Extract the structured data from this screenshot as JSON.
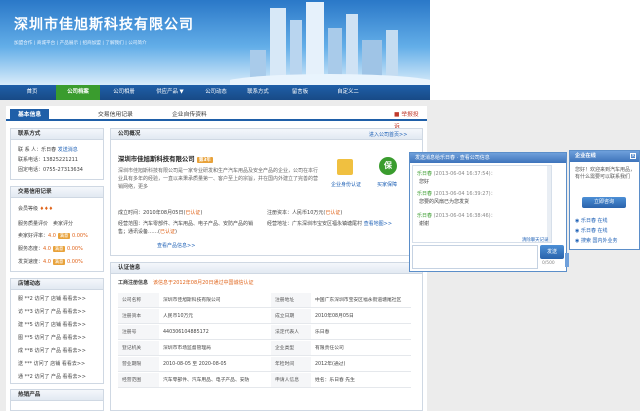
{
  "banner": {
    "title": "深圳市佳旭斯科技有限公司",
    "subtitle": "加盟合作 | 商城平台 | 产品展示 | 招商加盟 | 了解我们 | 公司简介"
  },
  "nav": [
    "首页",
    "公司档案",
    "公司相册",
    "供应产品 ▼",
    "公司动态",
    "联系方式",
    "留言板",
    "自定义二"
  ],
  "tabs": {
    "basic": "基本信息",
    "credit": "交易信用记录",
    "self": "企业自传资料",
    "report": "举报投诉"
  },
  "contact": {
    "title": "联系方式",
    "person": "联 系 人：乐日春",
    "chat_link": "发送消息",
    "mobile": "联系电话：13825221211",
    "phone": "固定电话：0755-27313634"
  },
  "trade": {
    "title": "交易信用记录",
    "level_label": "会员等级",
    "rating": "服务质量评价",
    "hint": "卖家评分",
    "rate_label": "卖家好评率：",
    "rate_val": "4.0",
    "rate_pct": "0.00%",
    "r1": "服务态度：",
    "r1v": "4.0",
    "r1p": "0.00%",
    "r2": "发货速度：",
    "r2v": "4.0",
    "r2p": "0.00%",
    "tag": "满意"
  },
  "reviews": {
    "title": "店铺动态",
    "items": [
      "服 **2 访问了 店铺 看看去>>",
      "访 **3 访问了 产品 看看去>>",
      "建 **5 访问了 店铺 看看去>>",
      "图 **5 访问了 产品 看看去>>",
      "成 **8 访问了 产品 看看去>>",
      "送 *** 访问了 店铺 看看去>>",
      "通 **2 访问了 产品 看看去>>"
    ]
  },
  "hot": {
    "title": "热销产品"
  },
  "overview": {
    "title": "公司概况",
    "enter": "进入公司首页>>",
    "name": "深圳市佳旭斯科技有限公司",
    "year": "第3年",
    "desc": "深圳市佳旭斯科技有限公司是一家专业研发和生产汽车用品及安全产品的企业，公司在本行业具有多年的经验，一直以来秉承质量第一、客户至上的宗旨，并在国内外建立了完善的营销网络，更多",
    "more": "更多",
    "cert1": "企业身份认证",
    "cert2": "买家保障"
  },
  "info": {
    "found_label": "成立时间：",
    "found": "2010年08月05日",
    "found_tag": "已认证",
    "cap_label": "注册资本：",
    "cap": "人民币10万元",
    "cap_tag": "已认证",
    "scope_label": "经营范围：",
    "scope": "汽车零部件、汽车用品、电子产品、安防产品的销售；通讯设备……",
    "scope_tag": "已认证",
    "addr_label": "经营地址：",
    "addr": "广东深圳市宝安区福永镇塘尾村",
    "addr_tag": "已认证",
    "map": "查看地图>>",
    "more": "查看产品信息>>"
  },
  "cert": {
    "title": "认证信息",
    "notice": "该信息于2012年08月20日通过中国诚信认证",
    "sub": "工商注册信息",
    "rows": [
      [
        "公司名称",
        "深圳市佳旭斯科技有限公司",
        "注册地址",
        "中国广东深圳市宝安区福永街道塘尾社区"
      ],
      [
        "注册资本",
        "人民币10万元",
        "成立日期",
        "2010年08月05日"
      ],
      [
        "注册号",
        "440306104885172",
        "法定代表人",
        "乐日春"
      ],
      [
        "登记机关",
        "深圳市市场监督管理局",
        "企业类型",
        "有限责任公司"
      ],
      [
        "营业期限",
        "2010-08-05 至 2020-08-05",
        "年检时间",
        "2012年(通过)"
      ],
      [
        "经营范围",
        "汽车零部件、汽车用品、电子产品、安防",
        "申请人信息",
        "姓名：乐日春 先生"
      ]
    ]
  },
  "chat": {
    "title": "发送消息给乐日春 · 查看公司信息",
    "m1n": "乐日春",
    "m1t": "(2013-06-04 16:37:54)：",
    "m1": "您好",
    "m2n": "乐日春",
    "m2t": "(2013-06-04 16:39:27)：",
    "m2": "您要的风扇已为您发货",
    "m3n": "乐日春",
    "m3t": "(2013-06-04 16:38:46)：",
    "m3": "谢谢",
    "clear": "清除聊天记录",
    "send": "发送",
    "count": "0/500"
  },
  "online": {
    "title": "企业在线",
    "text": "您好！欢迎来到汽车用品，有什么需要可以联系我们",
    "btn": "立即咨询",
    "links": [
      "乐日春 在线",
      "乐日春 在线",
      "搜索 国内外业务"
    ]
  }
}
